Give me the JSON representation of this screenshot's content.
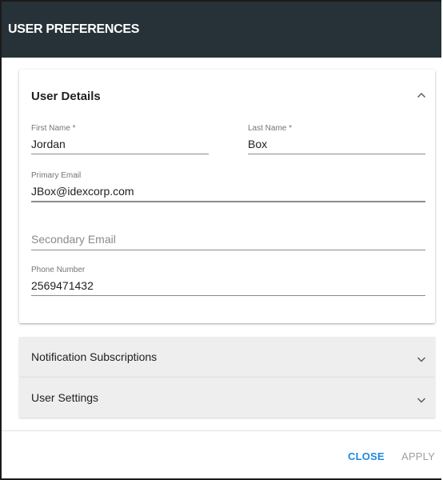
{
  "dialog": {
    "title": "USER PREFERENCES"
  },
  "user_details": {
    "title": "User Details",
    "expanded": true,
    "first_name": {
      "label": "First Name *",
      "value": "Jordan"
    },
    "last_name": {
      "label": "Last Name *",
      "value": "Box"
    },
    "primary_email": {
      "label": "Primary Email",
      "value": "JBox@idexcorp.com"
    },
    "secondary_email": {
      "placeholder": "Secondary Email",
      "value": ""
    },
    "phone_number": {
      "label": "Phone Number",
      "value": "2569471432"
    }
  },
  "notification_subscriptions": {
    "title": "Notification Subscriptions",
    "expanded": false
  },
  "user_settings": {
    "title": "User Settings",
    "expanded": false
  },
  "footer": {
    "close_label": "CLOSE",
    "apply_label": "APPLY"
  },
  "colors": {
    "header_bg": "#263238",
    "accent": "#1e88e5",
    "disabled": "#9e9e9e"
  },
  "icons": {
    "expand_open": "chevron-up-icon",
    "expand_closed": "chevron-down-icon"
  }
}
